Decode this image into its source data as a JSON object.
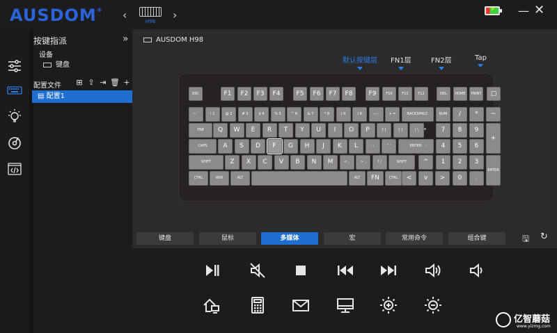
{
  "app": {
    "brand": "AUSDOM",
    "registered": "®",
    "device_name": "H98",
    "keyboard_title": "AUSDOM H98"
  },
  "panel": {
    "title": "按键指派",
    "device_label": "设备",
    "device_item": "键盘",
    "profile_label": "配置文件",
    "profile_item": "配置1"
  },
  "layers": [
    {
      "label": "默认按键层"
    },
    {
      "label": "FN1层"
    },
    {
      "label": "FN2层"
    },
    {
      "label": "Tap"
    }
  ],
  "tabs": [
    {
      "label": "键盘"
    },
    {
      "label": "鼠标"
    },
    {
      "label": "多媒体"
    },
    {
      "label": "宏"
    },
    {
      "label": "常用命令"
    },
    {
      "label": "组合键"
    }
  ],
  "keys": {
    "row0": [
      "ESC",
      "F1",
      "F2",
      "F3",
      "F4",
      "F5",
      "F6",
      "F7",
      "F8",
      "F9",
      "F10",
      "F11",
      "F12",
      "DEL",
      "HOME",
      "PRINT",
      "▢"
    ],
    "row1": [
      "~ `",
      "! 1",
      "@ 2",
      "# 3",
      "$ 4",
      "% 5",
      "^ 6",
      "& 7",
      "* 8",
      "( 9",
      ") 0",
      "— -",
      "+ =",
      "BACKSPACE",
      "NUM",
      "/",
      "*",
      "−"
    ],
    "row2": [
      "TAB",
      "Q",
      "W",
      "E",
      "R",
      "T",
      "Y",
      "U",
      "I",
      "O",
      "P",
      "{ [",
      "} ]",
      "| \\",
      "7",
      "8",
      "9",
      "+"
    ],
    "row3": [
      "CAPS",
      "A",
      "S",
      "D",
      "F",
      "G",
      "H",
      "J",
      "K",
      "L",
      ": ;",
      "\" '",
      "ENTER",
      "4",
      "5",
      "6"
    ],
    "row4": [
      "SHIFT",
      "Z",
      "X",
      "C",
      "V",
      "B",
      "N",
      "M",
      "< ,",
      "> .",
      "? /",
      "SHIFT",
      "^",
      "1",
      "2",
      "3",
      "ENTER"
    ],
    "row5": [
      "CTRL",
      "WIN",
      "ALT",
      "ALT",
      "FN",
      "CTRL",
      "<",
      "v",
      ">",
      "0",
      "."
    ]
  },
  "media_icons": [
    "play-pause-icon",
    "mute-icon",
    "stop-icon",
    "previous-track-icon",
    "next-track-icon",
    "volume-up-icon",
    "volume-down-icon",
    "home-page-icon",
    "calculator-icon",
    "mail-icon",
    "my-computer-icon",
    "brightness-up-icon",
    "brightness-down-icon"
  ],
  "watermark": {
    "name": "亿智蘑菇",
    "url": "www.yizmg.com"
  },
  "colors": {
    "accent": "#1f6fd1",
    "brand": "#2b63d9",
    "key": "#8b8b8b"
  }
}
